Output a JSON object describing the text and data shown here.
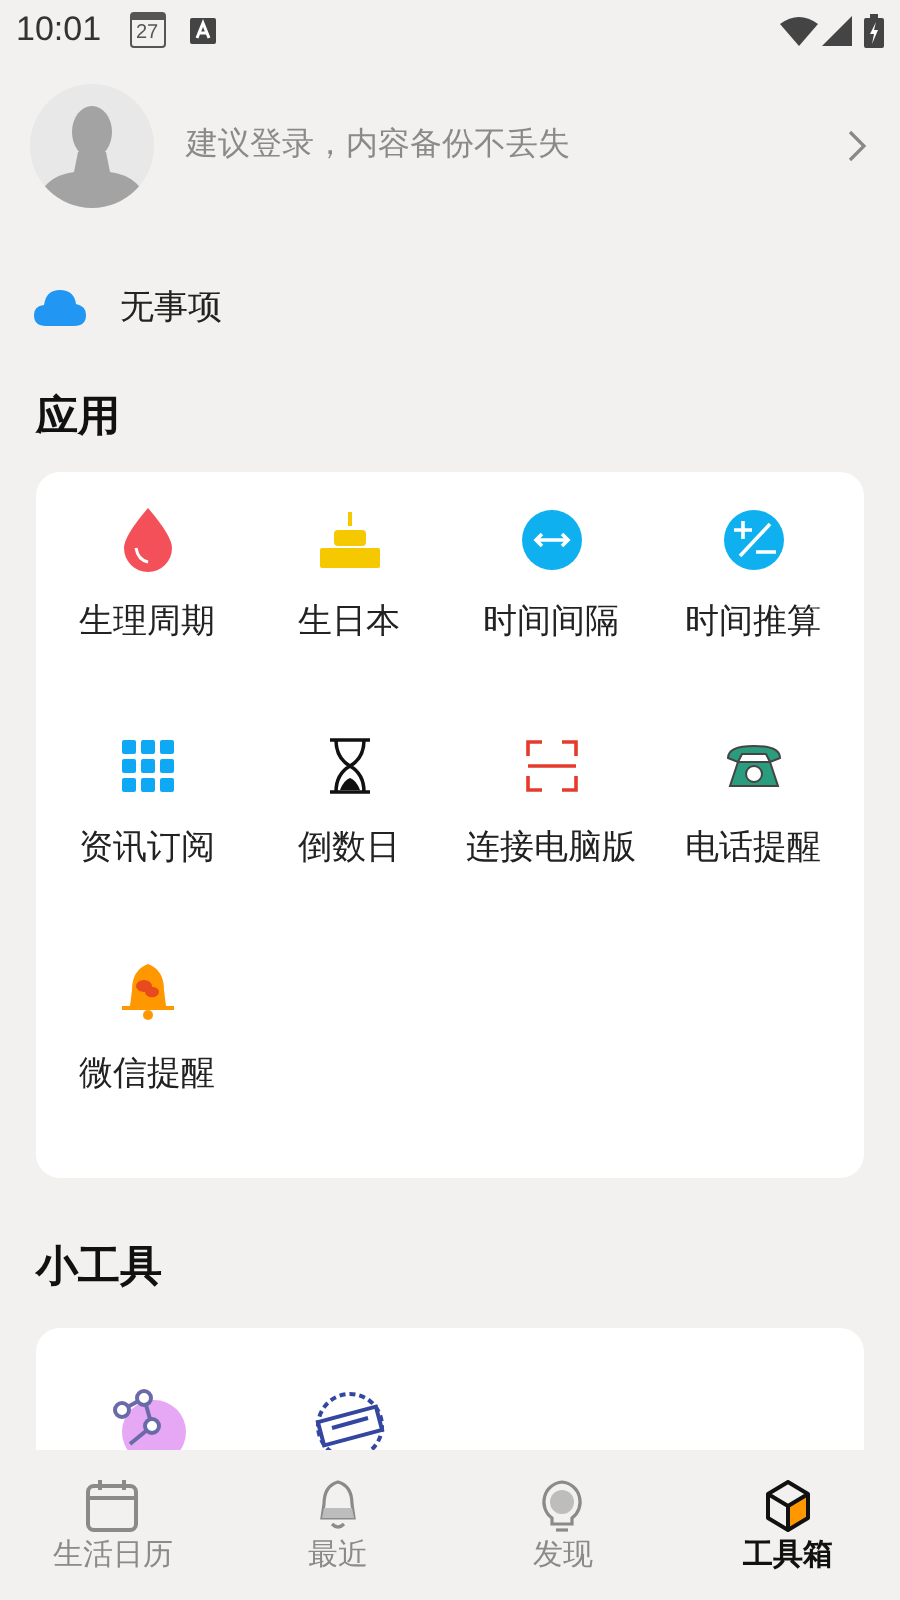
{
  "status_bar": {
    "time": "10:01",
    "calendar_day": "27"
  },
  "profile": {
    "prompt": "建议登录，内容备份不丢失"
  },
  "sync": {
    "label": "无事项"
  },
  "apps": {
    "title": "应用",
    "items": [
      {
        "kind": "drop",
        "label": "生理周期"
      },
      {
        "kind": "cake",
        "label": "生日本"
      },
      {
        "kind": "interval",
        "label": "时间间隔"
      },
      {
        "kind": "calc",
        "label": "时间推算"
      },
      {
        "kind": "grid",
        "label": "资讯订阅"
      },
      {
        "kind": "hourglass",
        "label": "倒数日"
      },
      {
        "kind": "scan",
        "label": "连接电脑版"
      },
      {
        "kind": "phone",
        "label": "电话提醒"
      },
      {
        "kind": "bell",
        "label": "微信提醒"
      }
    ]
  },
  "tools": {
    "title": "小工具",
    "items": [
      {
        "kind": "network"
      },
      {
        "kind": "stamp"
      }
    ]
  },
  "tab_bar": [
    {
      "kind": "calendar",
      "label": "生活日历",
      "selected": false
    },
    {
      "kind": "bell",
      "label": "最近",
      "selected": false
    },
    {
      "kind": "bulb",
      "label": "发现",
      "selected": false
    },
    {
      "kind": "box",
      "label": "工具箱",
      "selected": true
    }
  ]
}
